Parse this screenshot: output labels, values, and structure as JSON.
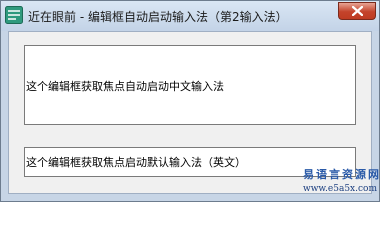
{
  "window": {
    "title": "近在眼前 - 编辑框自动启动输入法（第2输入法）",
    "app_icon": "app-icon",
    "close_icon": "close-icon"
  },
  "fields": [
    {
      "value": "这个编辑框获取焦点自动启动中文输入法"
    },
    {
      "value": "这个编辑框获取焦点启动默认输入法（英文）"
    }
  ],
  "watermark": {
    "name": "易语言资源网",
    "url": "www.e5a5x.com"
  },
  "colors": {
    "title_bar": "#c3d3e7",
    "close_button": "#c4432b",
    "client_background": "#f0f0f0"
  }
}
